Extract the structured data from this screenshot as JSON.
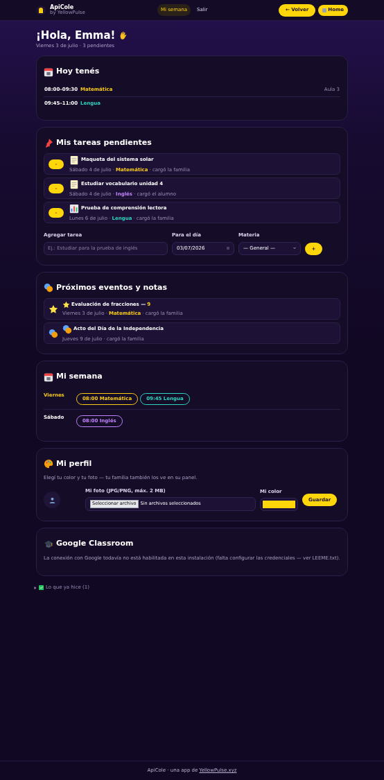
{
  "header": {
    "brand": "ApiCole",
    "byline": "by YellowPulse",
    "nav": [
      {
        "label": "Mi semana",
        "selected": true
      },
      {
        "label": "Salir",
        "selected": false
      }
    ],
    "back_button": "← Volver",
    "home_button": "Home"
  },
  "greeting": {
    "title": "¡Hola, Emma!",
    "subtitle": "Viernes 3 de julio · 3 pendientes"
  },
  "today": {
    "title": "Hoy tenés",
    "rows": [
      {
        "time": "08:00–09:30",
        "subject": "Matemática",
        "color": "#facc15",
        "room": "Aula 3"
      },
      {
        "time": "09:45–11:00",
        "subject": "Lengua",
        "color": "#2dd4bf"
      }
    ]
  },
  "tasks": {
    "title": "Mis tareas pendientes",
    "items": [
      {
        "kind": "homework",
        "title": "Maqueta del sistema solar",
        "date": "Sábado 4 de julio ·",
        "subject": "Matemática",
        "color": "#facc15",
        "author": "· cargó la familia",
        "done": false
      },
      {
        "kind": "homework",
        "title": "Estudiar vocabulario unidad 4",
        "date": "Sábado 4 de julio ·",
        "subject": "Inglés",
        "color": "#c084fc",
        "author": "· cargó el alumno",
        "done": false
      },
      {
        "kind": "exam",
        "title": "Prueba de comprensión lectora",
        "date": "Lunes 6 de julio ·",
        "subject": "Lengua",
        "color": "#2dd4bf",
        "author": "· cargó la familia",
        "done": false
      }
    ],
    "form": {
      "task_label": "Agregar tarea",
      "task_placeholder": "Ej.: Estudiar para la prueba de inglés",
      "date_label": "Para el día",
      "date_value": "03/07/2026",
      "subject_label": "Materia",
      "subject_value": "— General —",
      "add_button": "+"
    }
  },
  "events": {
    "title": "Próximos eventos y notas",
    "items": [
      {
        "kind": "grade",
        "title": "Evaluación de fracciones —",
        "grade": "9",
        "date": "Viernes 3 de julio ·",
        "subject": "Matemática",
        "color": "#facc15",
        "author": "· cargó la familia"
      },
      {
        "kind": "event",
        "title": "Acto del Día de la Independencia",
        "date": "Jueves 9 de julio ·",
        "author": "cargó la familia"
      }
    ]
  },
  "week": {
    "title": "Mi semana",
    "days": [
      {
        "day": "Viernes",
        "today": true,
        "classes": [
          {
            "label": "08:00 Matemática",
            "color": "#facc15"
          },
          {
            "label": "09:45 Lengua",
            "color": "#2dd4bf"
          }
        ]
      },
      {
        "day": "Sábado",
        "today": false,
        "classes": [
          {
            "label": "08:00 Inglés",
            "color": "#c084fc"
          }
        ]
      }
    ]
  },
  "profile": {
    "title": "Mi perfil",
    "description": "Elegí tu color y tu foto — tu familia también los ve en su panel.",
    "photo_label": "Mi foto (JPG/PNG, máx. 2 MB)",
    "file_button": "Seleccionar archivo",
    "file_status": "Sin archivos seleccionados",
    "color_label": "Mi color",
    "color": "#ffd60a",
    "save_button": "Guardar"
  },
  "classroom": {
    "title": "Google Classroom",
    "text": "La conexión con Google todavía no está habilitada en esta instalación (falta configurar las credenciales — ver LEEME.txt)."
  },
  "done": {
    "label": "Lo que ya hice (1)",
    "expanded": false
  },
  "footer": {
    "text": "ApiCole · una app de",
    "link": "YellowPulse.xyz"
  }
}
